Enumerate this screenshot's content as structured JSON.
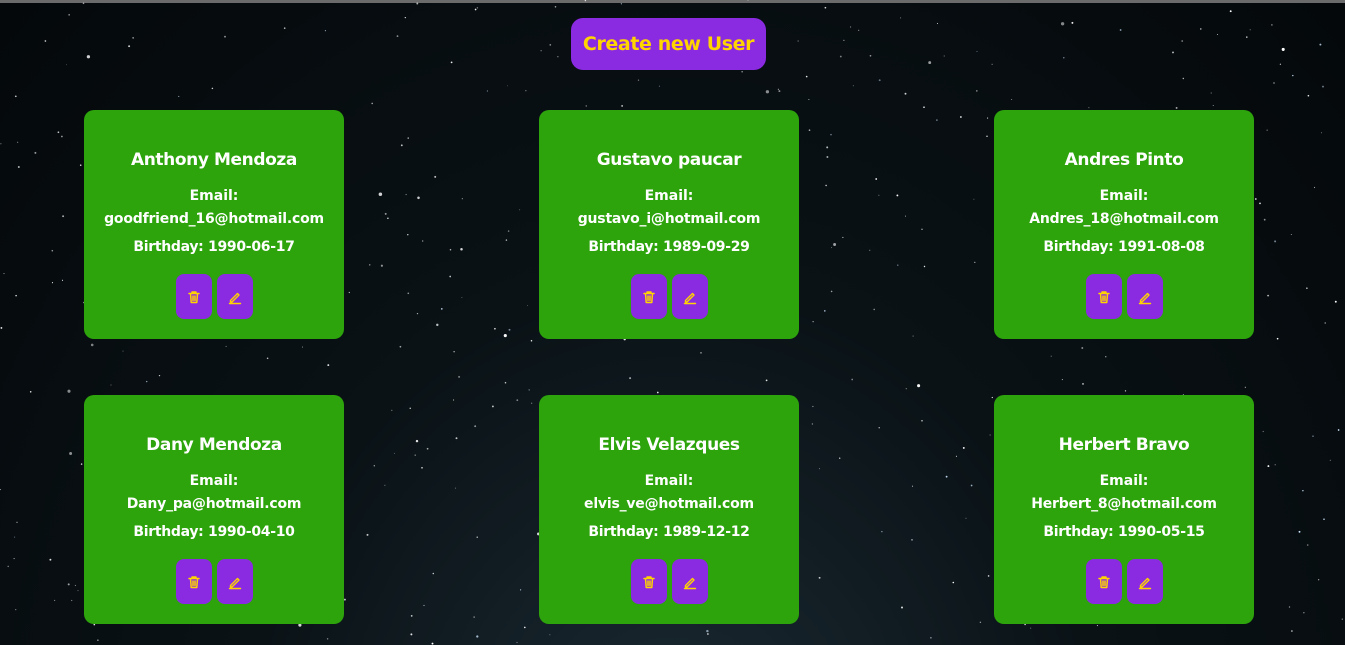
{
  "header": {
    "create_label": "Create new User"
  },
  "colors": {
    "card": "#2da40c",
    "button": "#8a2be2",
    "button_text": "#ffd400",
    "text": "#ffffff"
  },
  "icons": {
    "delete": "trash-icon",
    "edit": "pencil-icon"
  },
  "users": [
    {
      "name": "Anthony Mendoza",
      "email_label": "Email:",
      "email": "goodfriend_16@hotmail.com",
      "birthday": "Birthday: 1990-06-17"
    },
    {
      "name": "Gustavo paucar",
      "email_label": "Email:",
      "email": "gustavo_i@hotmail.com",
      "birthday": "Birthday: 1989-09-29"
    },
    {
      "name": "Andres Pinto",
      "email_label": "Email:",
      "email": "Andres_18@hotmail.com",
      "birthday": "Birthday: 1991-08-08"
    },
    {
      "name": "Dany Mendoza",
      "email_label": "Email:",
      "email": "Dany_pa@hotmail.com",
      "birthday": "Birthday: 1990-04-10"
    },
    {
      "name": "Elvis Velazques",
      "email_label": "Email:",
      "email": "elvis_ve@hotmail.com",
      "birthday": "Birthday: 1989-12-12"
    },
    {
      "name": "Herbert Bravo",
      "email_label": "Email:",
      "email": "Herbert_8@hotmail.com",
      "birthday": "Birthday: 1990-05-15"
    }
  ]
}
